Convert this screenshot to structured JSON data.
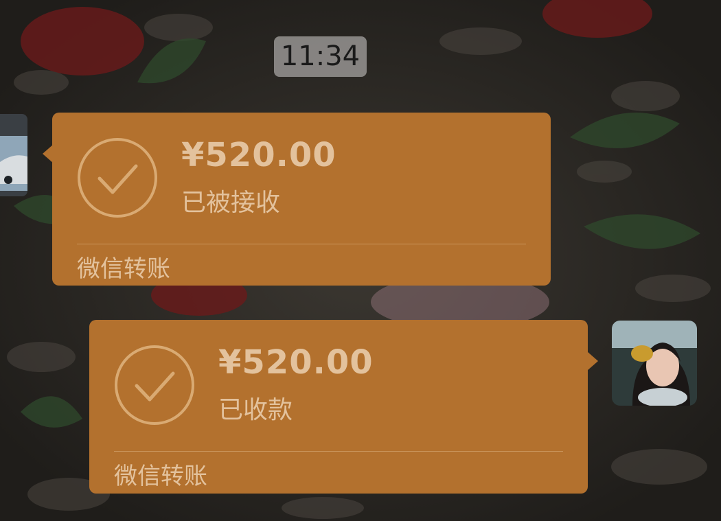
{
  "timestamp": "11:34",
  "messages": [
    {
      "direction": "incoming",
      "amount": "¥520.00",
      "status": "已被接收",
      "footer": "微信转账",
      "icon": "check-circle-icon"
    },
    {
      "direction": "outgoing",
      "amount": "¥520.00",
      "status": "已收款",
      "footer": "微信转账",
      "icon": "check-circle-icon"
    }
  ],
  "colors": {
    "bubble": "#b3712e",
    "bubble_text": "#e3c29d",
    "timestamp_bg": "#969492"
  }
}
